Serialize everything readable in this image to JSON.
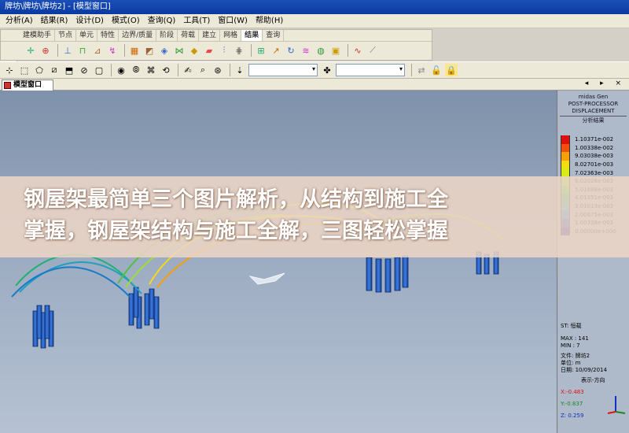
{
  "window": {
    "title": "牌坊\\牌坊\\牌坊2] - [模型窗口]"
  },
  "menu": [
    "分析(A)",
    "结果(R)",
    "设计(D)",
    "模式(O)",
    "查询(Q)",
    "工具(T)",
    "窗口(W)",
    "帮助(H)"
  ],
  "toolbar_tabs": [
    "建模助手",
    "节点",
    "单元",
    "特性",
    "边界/质量",
    "阶段",
    "荷载",
    "建立",
    "网格",
    "结果",
    "查询"
  ],
  "active_tab": "结果",
  "doc_tab": {
    "label": "模型窗口",
    "nav": "◂ ▸ ×"
  },
  "legend": {
    "product": "midas Gen",
    "processor": "POST-PROCESSOR",
    "mode": "DISPLACEMENT",
    "subtitle": "分析结果",
    "entries": [
      {
        "value": "1.10371e-002",
        "color": "#e01010"
      },
      {
        "value": "1.00338e-002",
        "color": "#f0500a"
      },
      {
        "value": "9.03038e-003",
        "color": "#f5a00a"
      },
      {
        "value": "8.02701e-003",
        "color": "#f5dc10"
      },
      {
        "value": "7.02363e-003",
        "color": "#d8ea18"
      },
      {
        "value": "6.02026e-003",
        "color": "#9ee030"
      },
      {
        "value": "5.01688e-003",
        "color": "#50d040"
      },
      {
        "value": "4.01351e-003",
        "color": "#20c080"
      },
      {
        "value": "3.01013e-003",
        "color": "#18b0c0"
      },
      {
        "value": "2.00675e-003",
        "color": "#1080e0"
      },
      {
        "value": "1.00338e-003",
        "color": "#1040d0"
      },
      {
        "value": "0.00000e+000",
        "color": "#1010a0"
      }
    ],
    "st": "ST: 恒载",
    "max": "MAX : 141",
    "min": "MIN : 7",
    "file": "文件: 牌坊2",
    "unit": "单位: m",
    "date": "日期: 10/09/2014",
    "view_dir": "表示-方向",
    "x": "X:-0.483",
    "y": "Y:-0.837",
    "z": "Z: 0.259"
  },
  "overlay": {
    "line1": "钢屋架最简单三个图片解析，从结构到施工全",
    "line2": "掌握，钢屋架结构与施工全解，三图轻松掌握"
  },
  "icons": {
    "row1": [
      "axes-icon",
      "node-icon",
      "element-icon",
      "beam-icon",
      "support-icon",
      "load-icon",
      "section-icon",
      "thickness-icon",
      "material-icon",
      "stage-icon",
      "result-icon",
      "contour-icon",
      "deform-icon",
      "display-icon",
      "query-icon",
      "wave-icon"
    ],
    "row2": [
      "select-icon",
      "window-select-icon",
      "polygon-icon",
      "intersect-icon",
      "plane-icon",
      "unselect-icon",
      "activate-icon",
      "inactive-icon",
      "all-icon",
      "invert-icon",
      "hand-icon",
      "zoom-icon",
      "rotate-icon",
      "lock-icon",
      "pin-icon"
    ]
  }
}
